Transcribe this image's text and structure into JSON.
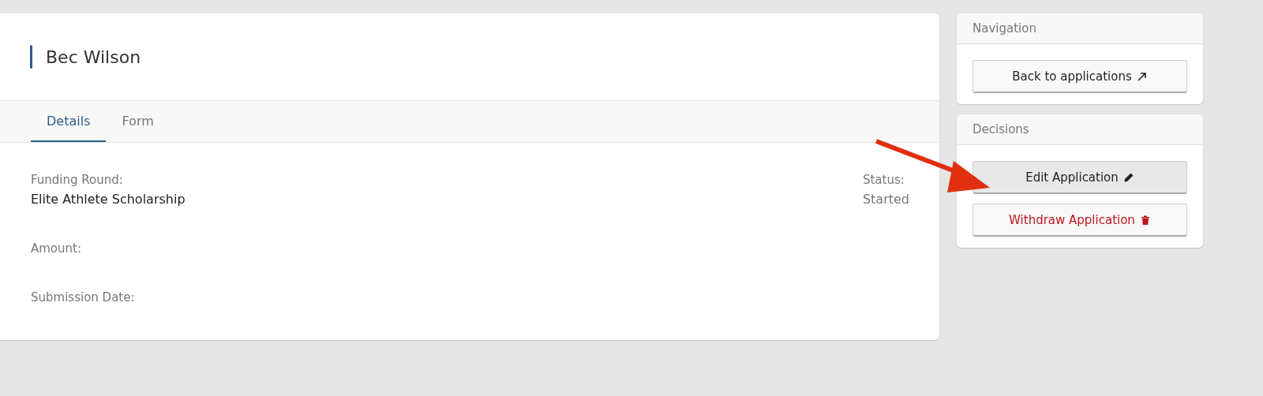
{
  "applicant": {
    "name": "Bec Wilson"
  },
  "tabs": [
    {
      "label": "Details",
      "selected": true
    },
    {
      "label": "Form",
      "selected": false
    }
  ],
  "details": {
    "fields": [
      {
        "label": "Funding Round:",
        "value": "Elite Athlete Scholarship"
      },
      {
        "label": "Amount:"
      },
      {
        "label": "Submission Date:"
      }
    ],
    "status": {
      "label": "Status:",
      "value": "Started"
    }
  },
  "panels": [
    {
      "title": "Navigation",
      "buttons": [
        {
          "label": "Back to applications",
          "kind": "link",
          "highlighted": false
        }
      ]
    },
    {
      "title": "Decisions",
      "buttons": [
        {
          "label": "Edit Application",
          "kind": "edit",
          "highlighted": true
        },
        {
          "label": "Withdraw Application",
          "kind": "danger",
          "highlighted": false
        }
      ]
    }
  ]
}
